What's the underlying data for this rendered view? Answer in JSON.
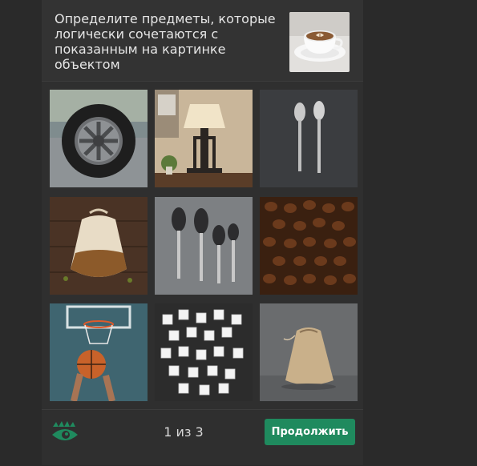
{
  "challenge": {
    "instruction": "Определите предметы, которые логически сочетаются с показанным на картинке объектом",
    "sample_image": "coffee-cup-image"
  },
  "tiles": [
    {
      "subject": "car-tire-image"
    },
    {
      "subject": "table-lamp-image"
    },
    {
      "subject": "two-spoons-image"
    },
    {
      "subject": "tea-bag-pouch-image"
    },
    {
      "subject": "spoon-set-image"
    },
    {
      "subject": "coffee-beans-image"
    },
    {
      "subject": "basketball-hoop-image"
    },
    {
      "subject": "sugar-cubes-image"
    },
    {
      "subject": "burlap-pouch-image"
    }
  ],
  "footer": {
    "pager": "1 из 3",
    "continue_label": "Продолжить",
    "logo": "eye-logo-icon"
  },
  "colors": {
    "background": "#2a2a2a",
    "panel": "#2f2f2f",
    "button": "#1f8a5e",
    "logo": "#1f8a5e"
  }
}
